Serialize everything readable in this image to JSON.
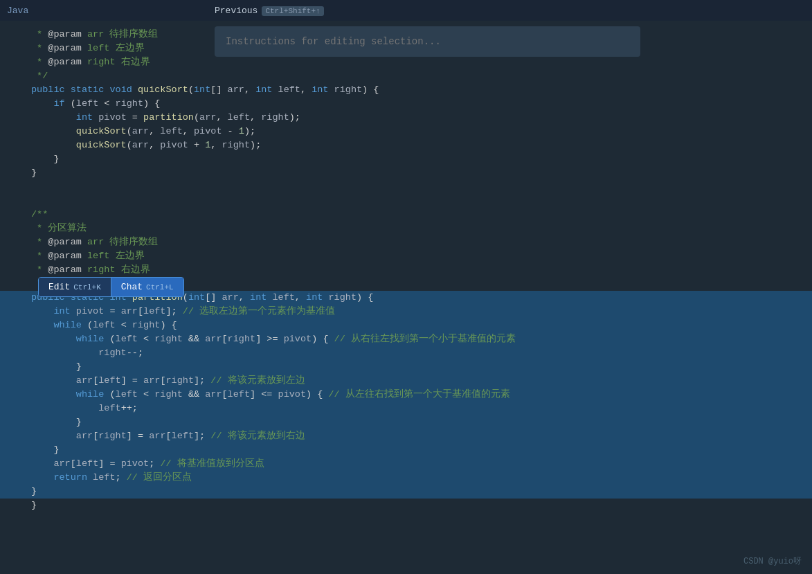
{
  "topbar": {
    "title": "Java"
  },
  "previous_btn": {
    "label": "Previous",
    "shortcut": "Ctrl+Shift+↑"
  },
  "instruction_box": {
    "placeholder": "Instructions for editing selection..."
  },
  "edit_chat_popup": {
    "edit_label": "Edit",
    "edit_shortcut": "Ctrl+K",
    "chat_label": "Chat",
    "chat_shortcut": "Ctrl+L"
  },
  "watermark": {
    "text": "CSDN @yuio呀"
  },
  "code": {
    "lines": [
      {
        "num": "",
        "content": " * @param arr 待排序数组",
        "selected": false
      },
      {
        "num": "",
        "content": " * @param left 左边界",
        "selected": false
      },
      {
        "num": "",
        "content": " * @param right 右边界",
        "selected": false
      },
      {
        "num": "",
        "content": " */",
        "selected": false
      },
      {
        "num": "",
        "content": "public static void quickSort(int[] arr, int left, int right) {",
        "selected": false
      },
      {
        "num": "",
        "content": "    if (left < right) {",
        "selected": false
      },
      {
        "num": "",
        "content": "        int pivot = partition(arr, left, right);",
        "selected": false
      },
      {
        "num": "",
        "content": "        quickSort(arr, left, pivot - 1);",
        "selected": false
      },
      {
        "num": "",
        "content": "        quickSort(arr, pivot + 1, right);",
        "selected": false
      },
      {
        "num": "",
        "content": "    }",
        "selected": false
      },
      {
        "num": "",
        "content": "}",
        "selected": false
      },
      {
        "num": "",
        "content": "",
        "selected": false
      },
      {
        "num": "",
        "content": "",
        "selected": false
      },
      {
        "num": "",
        "content": "/**",
        "selected": false
      },
      {
        "num": "",
        "content": " * 分区算法",
        "selected": false
      },
      {
        "num": "",
        "content": " * @param arr 待排序数组",
        "selected": false
      },
      {
        "num": "",
        "content": " * @param left 左边界",
        "selected": false
      },
      {
        "num": "",
        "content": " * @param right 右边界",
        "selected": false
      },
      {
        "num": "",
        "content": " */",
        "selected": false
      },
      {
        "num": "",
        "content": "public static int partition(int[] arr, int left, int right) {",
        "selected": true
      },
      {
        "num": "",
        "content": "    int pivot = arr[left]; // 选取左边第一个元素作为基准值",
        "selected": true
      },
      {
        "num": "",
        "content": "    while (left < right) {",
        "selected": true
      },
      {
        "num": "",
        "content": "        while (left < right && arr[right] >= pivot) { // 从右往左找到第一个小于基准值的元素",
        "selected": true
      },
      {
        "num": "",
        "content": "            right--;",
        "selected": true
      },
      {
        "num": "",
        "content": "        }",
        "selected": true
      },
      {
        "num": "",
        "content": "        arr[left] = arr[right]; // 将该元素放到左边",
        "selected": true
      },
      {
        "num": "",
        "content": "        while (left < right && arr[left] <= pivot) { // 从左往右找到第一个大于基准值的元素",
        "selected": true
      },
      {
        "num": "",
        "content": "            left++;",
        "selected": true
      },
      {
        "num": "",
        "content": "        }",
        "selected": true
      },
      {
        "num": "",
        "content": "        arr[right] = arr[left]; // 将该元素放到右边",
        "selected": true
      },
      {
        "num": "",
        "content": "    }",
        "selected": true
      },
      {
        "num": "",
        "content": "    arr[left] = pivot; // 将基准值放到分区点",
        "selected": true
      },
      {
        "num": "",
        "content": "    return left; // 返回分区点",
        "selected": true
      },
      {
        "num": "",
        "content": "}",
        "selected": true
      },
      {
        "num": "",
        "content": "}",
        "selected": false
      }
    ]
  }
}
